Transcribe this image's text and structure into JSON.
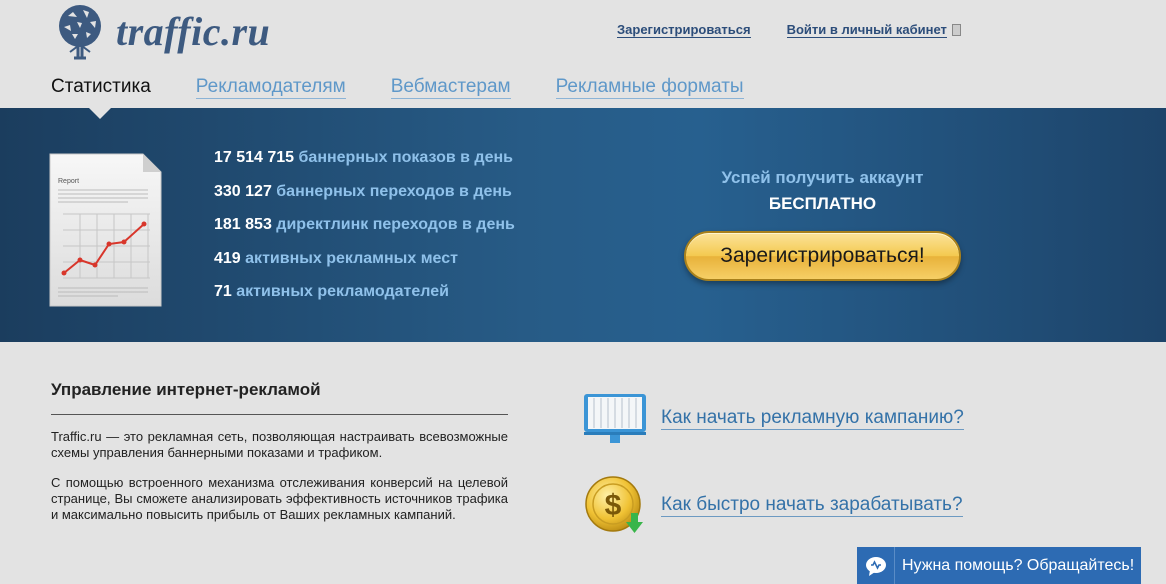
{
  "header": {
    "logo_text": "traffic.ru",
    "links": {
      "register": "Зарегистрироваться",
      "login": "Войти в личный кабинет"
    }
  },
  "nav": {
    "items": [
      {
        "label": "Статистика",
        "active": true
      },
      {
        "label": "Рекламодателям",
        "active": false
      },
      {
        "label": "Вебмастерам",
        "active": false
      },
      {
        "label": "Рекламные форматы",
        "active": false
      }
    ]
  },
  "banner": {
    "report_title": "Report",
    "stats": [
      {
        "value": "17 514 715",
        "label": "баннерных показов в день"
      },
      {
        "value": "330 127",
        "label": "баннерных переходов в день"
      },
      {
        "value": "181 853",
        "label": "директлинк переходов в день"
      },
      {
        "value": "419",
        "label": "активных рекламных мест"
      },
      {
        "value": "71",
        "label": "активных рекламодателей"
      }
    ],
    "cta": {
      "line1": "Успей получить аккаунт",
      "line2": "БЕСПЛАТНО",
      "button": "Зарегистрироваться!"
    }
  },
  "about": {
    "title": "Управление интернет-рекламой",
    "paragraphs": [
      "Traffic.ru — это рекламная сеть, позволяющая настраивать всевозможные схемы управления баннерными показами и трафиком.",
      "С помощью встроенного механизма отслеживания конверсий на целевой странице, Вы сможете анализировать эффективность источников трафика и максимально повысить прибыль от Ваших рекламных кампаний."
    ]
  },
  "howto": [
    {
      "label": "Как начать рекламную кампанию?",
      "icon": "billboard-icon"
    },
    {
      "label": "Как быстро начать зарабатывать?",
      "icon": "dollar-coin-icon"
    }
  ],
  "help": {
    "label": "Нужна помощь? Обращайтесь!"
  },
  "colors": {
    "banner": "#275b86",
    "nav_link": "#5f98c9",
    "stat_label": "#8fc1ea",
    "cta_button": "#f4c94f",
    "help_bar": "#2d6bb3"
  }
}
